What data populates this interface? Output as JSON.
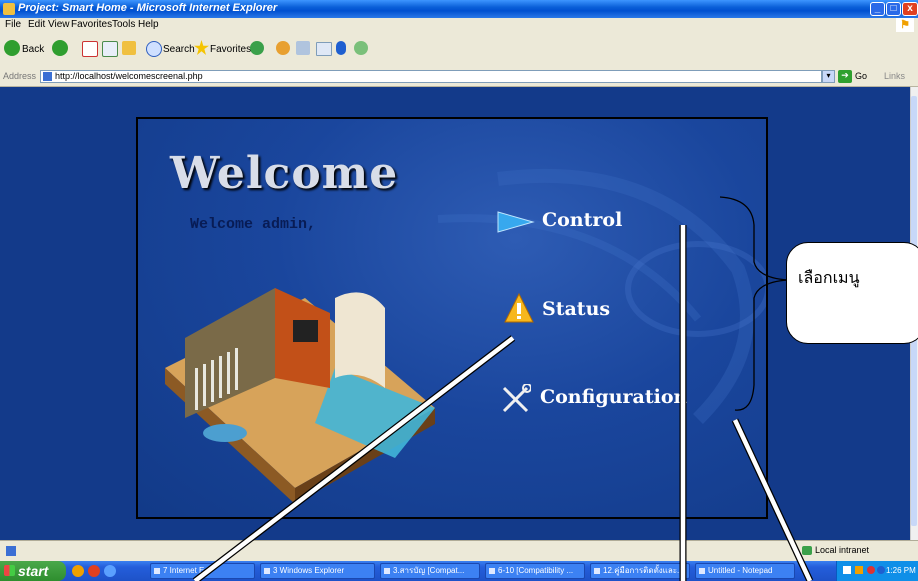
{
  "window": {
    "title": "Project: Smart Home - Microsoft Internet Explorer",
    "minimize": "_",
    "maximize": "□",
    "close": "x"
  },
  "menubar": [
    "File",
    "Edit",
    "View",
    "Favorites",
    "Tools",
    "Help"
  ],
  "toolbar": {
    "back": "Back",
    "search": "Search",
    "favorites": "Favorites"
  },
  "address": {
    "label": "Address",
    "url": "http://localhost/welcomescreenal.php",
    "go": "Go",
    "links": "Links"
  },
  "page": {
    "heading": "Welcome",
    "greeting": "Welcome admin,",
    "menu": [
      {
        "label": "Control",
        "icon": "play-triangle-icon"
      },
      {
        "label": "Status",
        "icon": "warning-icon"
      },
      {
        "label": "Configuration",
        "icon": "tools-icon"
      }
    ]
  },
  "statusbar": {
    "zone": "Local intranet"
  },
  "taskbar": {
    "start": "start",
    "tasks": [
      "7 Internet E...",
      "3 Windows Explorer",
      "3.สารบัญ [Compat...",
      "6-10 [Compatibility ...",
      "12.คู่มือการติดตั้งและ...",
      "Untitled - Notepad"
    ],
    "clock": "1:26 PM"
  },
  "annotation": {
    "text": "เลือกเมนู"
  },
  "colors": {
    "page_bg": "#133a8a",
    "panel_bg": "#1a469d",
    "titlebar": "#0050d0",
    "taskbar": "#245edb",
    "start_green": "#2e8e2e"
  }
}
